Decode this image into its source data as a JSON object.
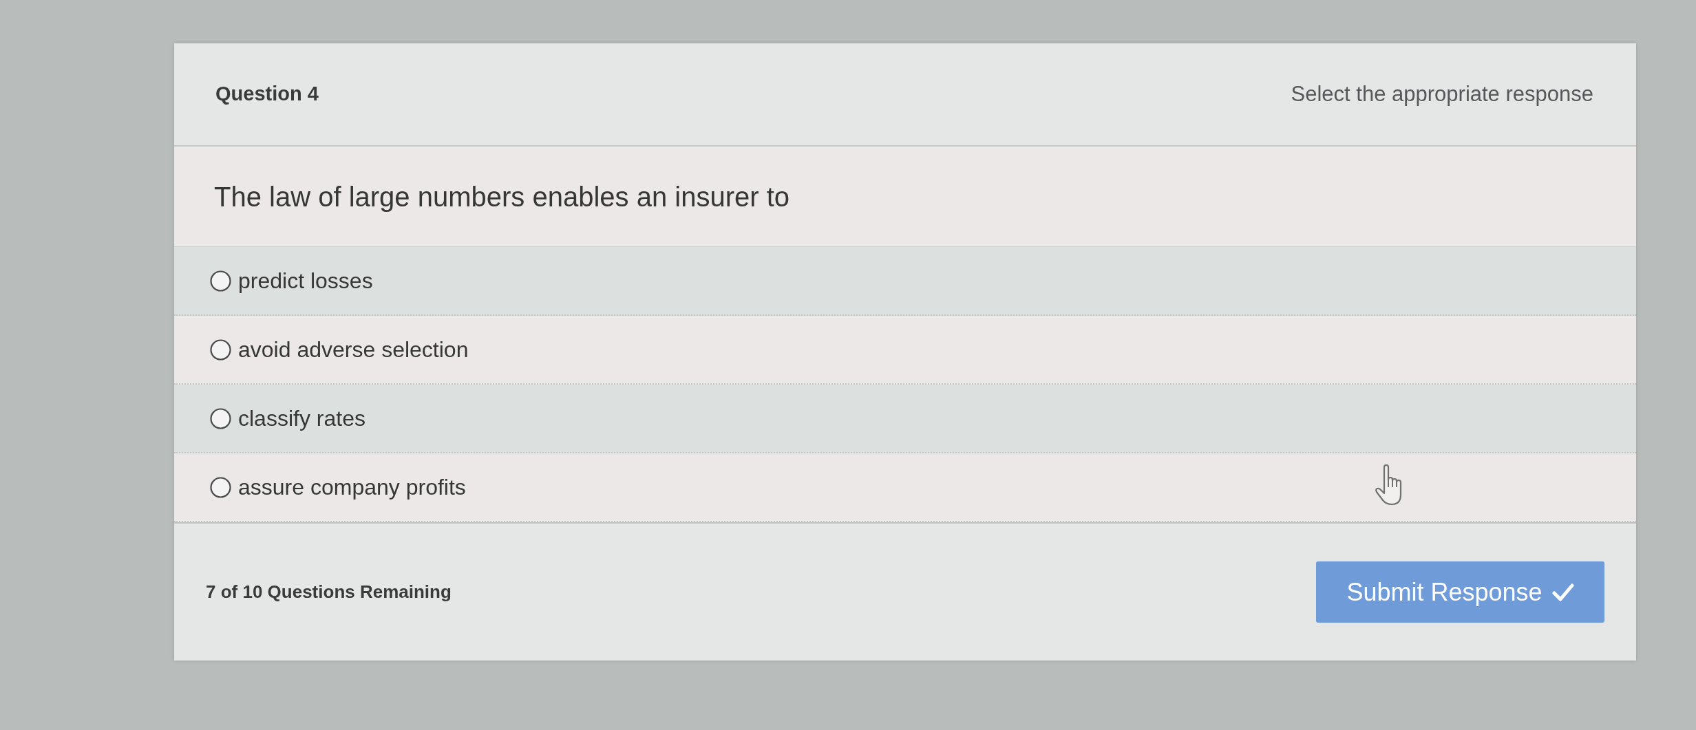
{
  "header": {
    "title": "Question 4",
    "instruction": "Select the appropriate response"
  },
  "question": {
    "text": "The law of large numbers enables an insurer to"
  },
  "options": [
    {
      "label": "predict losses",
      "selected": false
    },
    {
      "label": "avoid adverse selection",
      "selected": false
    },
    {
      "label": "classify rates",
      "selected": false
    },
    {
      "label": "assure company profits",
      "selected": false
    }
  ],
  "footer": {
    "progress": "7 of 10 Questions Remaining",
    "submit_button": {
      "label": "Submit Response"
    }
  }
}
